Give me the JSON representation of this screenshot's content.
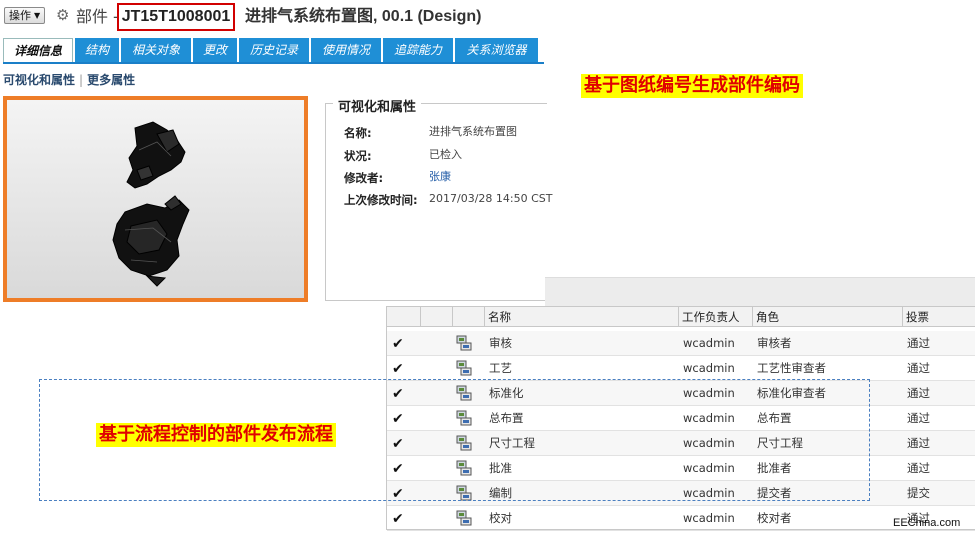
{
  "header": {
    "ops_label": "操作",
    "object_type": "部件",
    "separator": "-",
    "object_number": "JT15T1008001",
    "object_title": "进排气系统布置图, 00.1 (Design)"
  },
  "tabs": [
    {
      "label": "详细信息",
      "active": true
    },
    {
      "label": "结构",
      "active": false
    },
    {
      "label": "相关对象",
      "active": false
    },
    {
      "label": "更改",
      "active": false
    },
    {
      "label": "历史记录",
      "active": false
    },
    {
      "label": "使用情况",
      "active": false
    },
    {
      "label": "追踪能力",
      "active": false
    },
    {
      "label": "关系浏览器",
      "active": false
    }
  ],
  "subnav": {
    "visualization": "可视化和属性",
    "divider": "|",
    "more": "更多属性"
  },
  "attributes": {
    "heading": "可视化和属性",
    "rows": [
      {
        "label": "名称:",
        "value": "进排气系统布置图"
      },
      {
        "label": "状况:",
        "value": "已检入"
      },
      {
        "label": "修改者:",
        "value": "张康"
      },
      {
        "label": "上次修改时间:",
        "value": "2017/03/28 14:50 CST"
      }
    ]
  },
  "callouts": {
    "top": "基于图纸编号生成部件编码",
    "bottom": "基于流程控制的部件发布流程"
  },
  "table": {
    "headers": [
      "",
      "",
      "",
      "名称",
      "工作负责人",
      "角色",
      "投票"
    ],
    "rows": [
      {
        "name": "审核",
        "owner": "wcadmin",
        "role": "审核者",
        "vote": "通过"
      },
      {
        "name": "工艺",
        "owner": "wcadmin",
        "role": "工艺性审查者",
        "vote": "通过"
      },
      {
        "name": "标准化",
        "owner": "wcadmin",
        "role": "标准化审查者",
        "vote": "通过"
      },
      {
        "name": "总布置",
        "owner": "wcadmin",
        "role": "总布置",
        "vote": "通过"
      },
      {
        "name": "尺寸工程",
        "owner": "wcadmin",
        "role": "尺寸工程",
        "vote": "通过"
      },
      {
        "name": "批准",
        "owner": "wcadmin",
        "role": "批准者",
        "vote": "通过"
      },
      {
        "name": "编制",
        "owner": "wcadmin",
        "role": "提交者",
        "vote": "提交"
      },
      {
        "name": "校对",
        "owner": "wcadmin",
        "role": "校对者",
        "vote": "通过"
      }
    ]
  },
  "watermark": "EEChina.com",
  "colors": {
    "tab_blue": "#1f8fd6",
    "highlight_border": "#d10000",
    "image_border": "#ee7d28",
    "callout_bg": "#ffff00",
    "callout_text": "#e00000",
    "dashed_border": "#4a7fc0"
  },
  "icons": {
    "gear": "gear-icon",
    "check": "checkmark-icon",
    "task": "workflow-task-icon",
    "dropdown": "chevron-down-icon"
  }
}
